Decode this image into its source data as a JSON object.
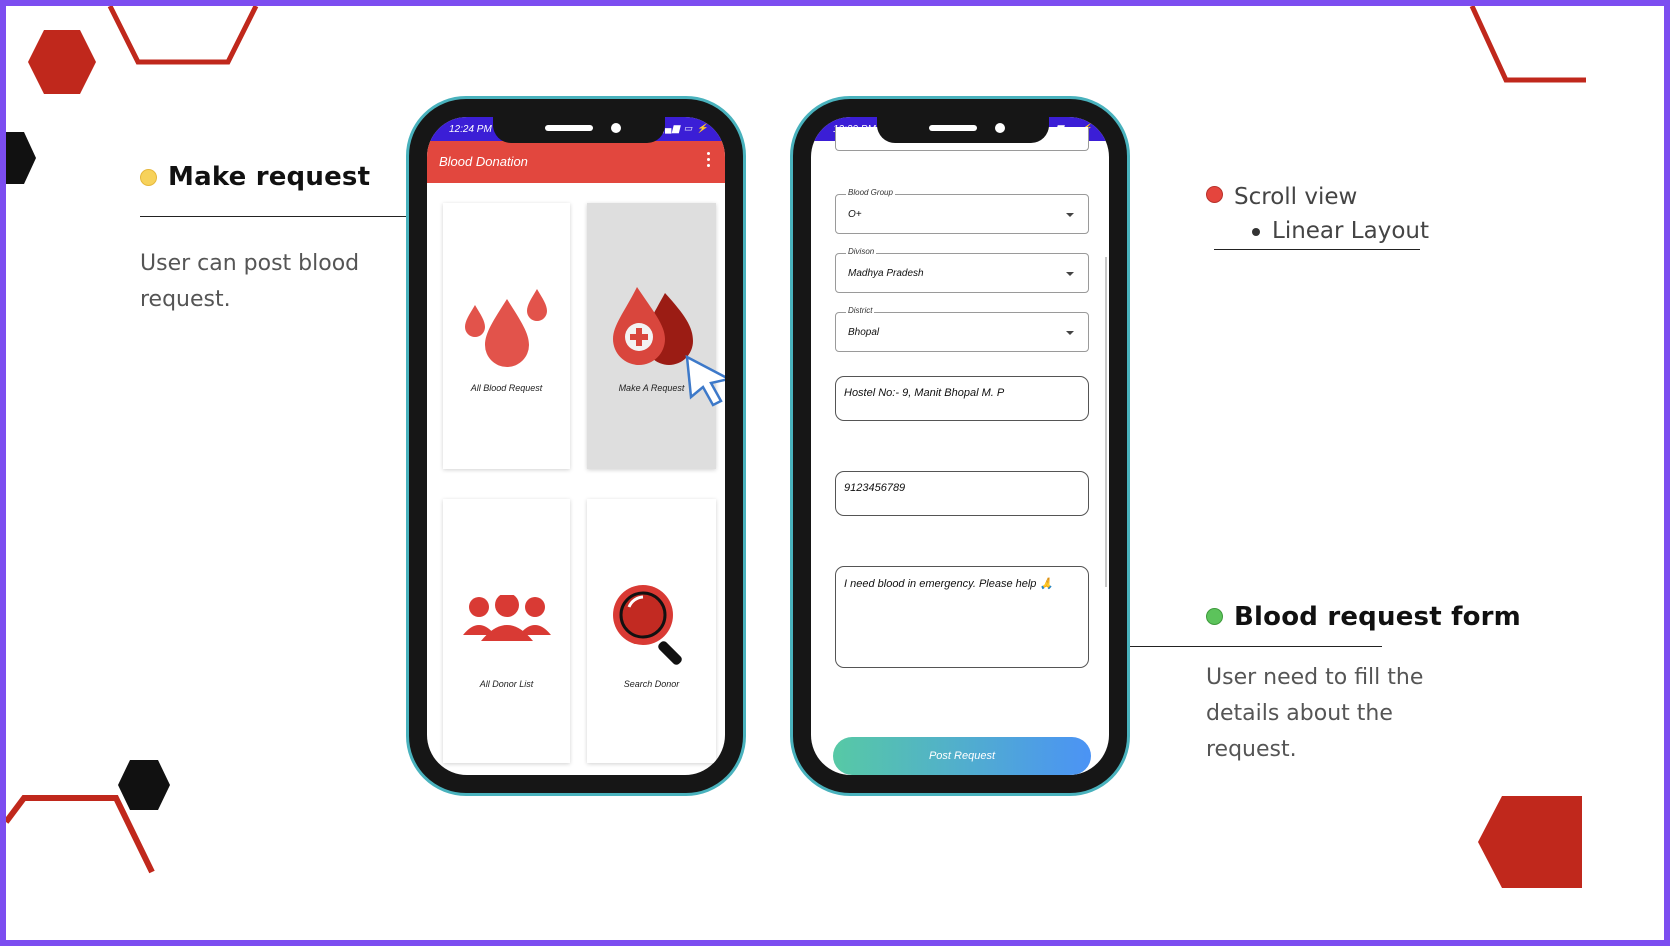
{
  "annotations": {
    "make_request": {
      "title": "Make request",
      "description": "User can post blood request.",
      "dot_color": "#f7d25b"
    },
    "scroll_view": {
      "title": "Scroll view",
      "sub_item": "Linear Layout",
      "dot_color": "#e5453d"
    },
    "blood_form": {
      "title": "Blood request form",
      "description": "User need to fill the details about the request.",
      "dot_color": "#5cc35b"
    }
  },
  "phone_home": {
    "status": {
      "time": "12:24 PM",
      "icons": "▮▮ ▂▄▆ ▭ ⚡"
    },
    "appbar": {
      "title": "Blood Donation"
    },
    "cards": [
      {
        "label": "All Blood Request",
        "icon": "blood-drops-icon"
      },
      {
        "label": "Make A Request",
        "icon": "blood-drop-plus-icon",
        "selected": true
      },
      {
        "label": "All Donor List",
        "icon": "people-group-icon"
      },
      {
        "label": "Search Donor",
        "icon": "magnifier-icon"
      }
    ]
  },
  "phone_form": {
    "status": {
      "time": "12:29 PM",
      "icons": "▮ ▂▄▆ ▭ ⚡"
    },
    "fields": {
      "blood_group": {
        "label": "Blood Group",
        "value": "O+"
      },
      "division": {
        "label": "Divison",
        "value": "Madhya Pradesh"
      },
      "district": {
        "label": "District",
        "value": "Bhopal"
      }
    },
    "address": "Hostel No:- 9, Manit Bhopal M. P",
    "phone": "9123456789",
    "message": "I need blood in emergency. Please help 🙏",
    "submit_label": "Post Request"
  },
  "colors": {
    "frame": "#7c4df0",
    "accent_red": "#c0281c",
    "phone_border": "#49b2bd",
    "status_bar": "#3b1ed6",
    "app_bar": "#e2473e"
  }
}
